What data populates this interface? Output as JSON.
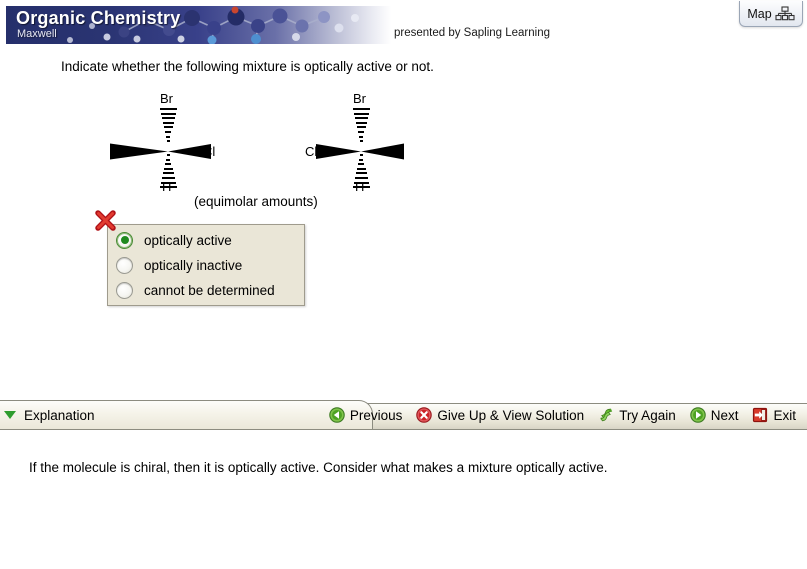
{
  "header": {
    "course_title": "Organic Chemistry",
    "author": "Maxwell",
    "presented_by": "presented by Sapling Learning",
    "map_button": {
      "label": "Map",
      "icon": "sitemap-icon"
    }
  },
  "question": {
    "prompt": "Indicate whether the following mixture is optically active or not.",
    "caption": "(equimolar amounts)",
    "structures": [
      {
        "name": "structure-left",
        "top_label": "Br",
        "bottom_label": "H",
        "right_label": "Cl",
        "left_label": "",
        "top_bond": "hashed",
        "bottom_bond": "hashed",
        "left_bond": "wedge",
        "right_bond": "wedge"
      },
      {
        "name": "structure-right",
        "top_label": "Br",
        "bottom_label": "H",
        "right_label": "",
        "left_label": "Cl",
        "top_bond": "hashed",
        "bottom_bond": "hashed",
        "left_bond": "wedge",
        "right_bond": "wedge"
      }
    ]
  },
  "answer": {
    "options": [
      {
        "label": "optically active",
        "selected": true
      },
      {
        "label": "optically inactive",
        "selected": false
      },
      {
        "label": "cannot be determined",
        "selected": false
      }
    ],
    "result_icon": "red-x-incorrect-icon",
    "panel_bg": "#eae6d7",
    "selected_color": "#1f8a1f",
    "incorrect_color": "#c4161c"
  },
  "toolbar": {
    "explanation_tab_label": "Explanation",
    "buttons": [
      {
        "label": "Previous",
        "icon": "previous-arrow-icon",
        "color": "#3f9e3f"
      },
      {
        "label": "Give Up & View Solution",
        "icon": "give-up-x-icon",
        "color": "#cc2127"
      },
      {
        "label": "Try Again",
        "icon": "try-again-refresh-icon",
        "color": "#4caf28"
      },
      {
        "label": "Next",
        "icon": "next-arrow-icon",
        "color": "#3f9e3f"
      },
      {
        "label": "Exit",
        "icon": "exit-door-icon",
        "color": "#cc2127"
      }
    ]
  },
  "explanation": {
    "text": "If the molecule is chiral, then it is optically active. Consider what makes a mixture optically active."
  }
}
